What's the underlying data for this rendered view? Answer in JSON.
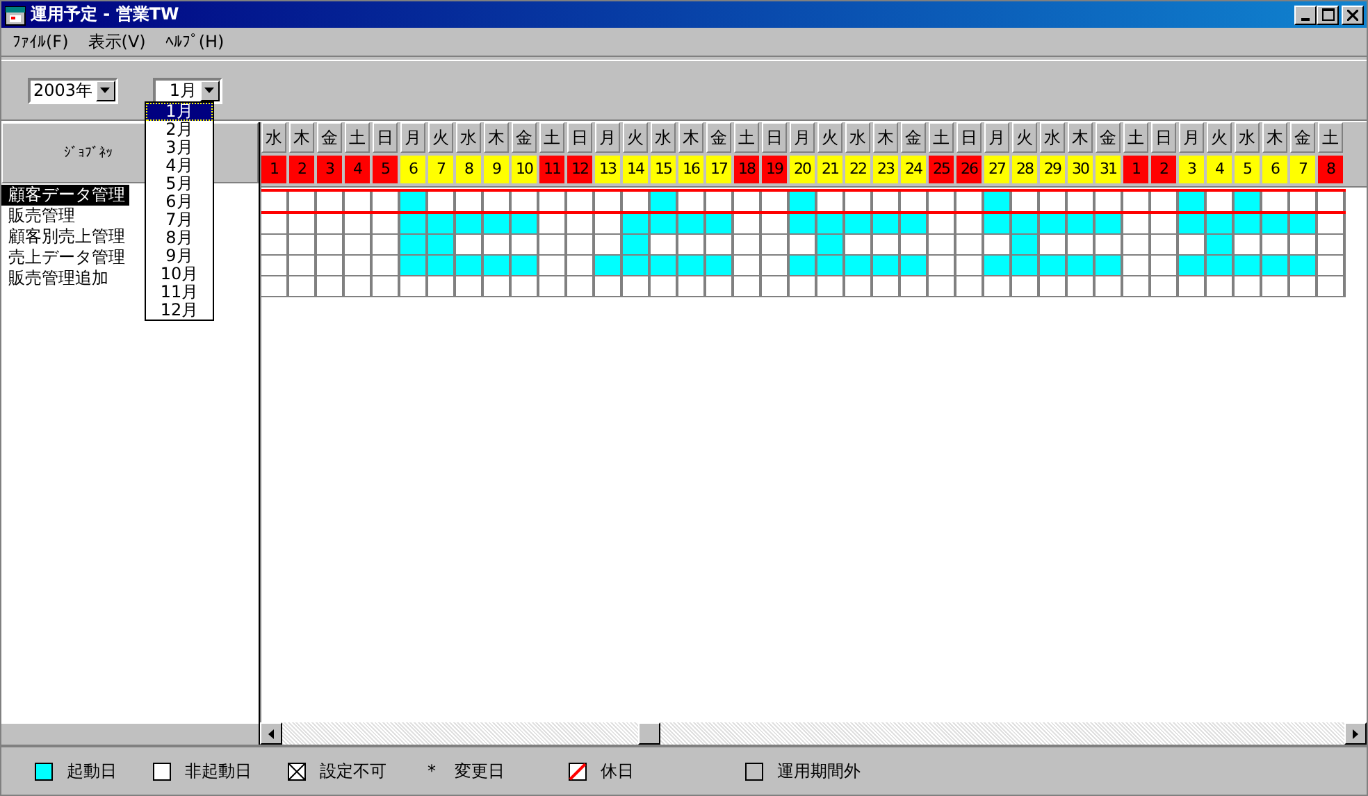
{
  "window": {
    "title": "運用予定 - 営業TW"
  },
  "menu": [
    "ﾌｧｲﾙ(F)",
    "表示(V)",
    "ﾍﾙﾌﾟ(H)"
  ],
  "year_select": {
    "value": "2003年"
  },
  "month_select": {
    "value": "1月",
    "expanded": true,
    "options": [
      {
        "label": "1月",
        "selected": true
      },
      {
        "label": "2月",
        "selected": false
      },
      {
        "label": "3月",
        "selected": false
      },
      {
        "label": "4月",
        "selected": false
      },
      {
        "label": "5月",
        "selected": false
      },
      {
        "label": "6月",
        "selected": false
      },
      {
        "label": "7月",
        "selected": false
      },
      {
        "label": "8月",
        "selected": false
      },
      {
        "label": "9月",
        "selected": false
      },
      {
        "label": "10月",
        "selected": false
      },
      {
        "label": "11月",
        "selected": false
      },
      {
        "label": "12月",
        "selected": false
      }
    ]
  },
  "job_header": "ｼﾞｮﾌﾞﾈｯ",
  "days": [
    {
      "weekday": "水",
      "date": "1",
      "holiday": true
    },
    {
      "weekday": "木",
      "date": "2",
      "holiday": true
    },
    {
      "weekday": "金",
      "date": "3",
      "holiday": true
    },
    {
      "weekday": "土",
      "date": "4",
      "holiday": true
    },
    {
      "weekday": "日",
      "date": "5",
      "holiday": true
    },
    {
      "weekday": "月",
      "date": "6",
      "holiday": false
    },
    {
      "weekday": "火",
      "date": "7",
      "holiday": false
    },
    {
      "weekday": "水",
      "date": "8",
      "holiday": false
    },
    {
      "weekday": "木",
      "date": "9",
      "holiday": false
    },
    {
      "weekday": "金",
      "date": "10",
      "holiday": false
    },
    {
      "weekday": "土",
      "date": "11",
      "holiday": true
    },
    {
      "weekday": "日",
      "date": "12",
      "holiday": true
    },
    {
      "weekday": "月",
      "date": "13",
      "holiday": false
    },
    {
      "weekday": "火",
      "date": "14",
      "holiday": false
    },
    {
      "weekday": "水",
      "date": "15",
      "holiday": false
    },
    {
      "weekday": "木",
      "date": "16",
      "holiday": false
    },
    {
      "weekday": "金",
      "date": "17",
      "holiday": false
    },
    {
      "weekday": "土",
      "date": "18",
      "holiday": true
    },
    {
      "weekday": "日",
      "date": "19",
      "holiday": true
    },
    {
      "weekday": "月",
      "date": "20",
      "holiday": false
    },
    {
      "weekday": "火",
      "date": "21",
      "holiday": false
    },
    {
      "weekday": "水",
      "date": "22",
      "holiday": false
    },
    {
      "weekday": "木",
      "date": "23",
      "holiday": false
    },
    {
      "weekday": "金",
      "date": "24",
      "holiday": false
    },
    {
      "weekday": "土",
      "date": "25",
      "holiday": true
    },
    {
      "weekday": "日",
      "date": "26",
      "holiday": true
    },
    {
      "weekday": "月",
      "date": "27",
      "holiday": false
    },
    {
      "weekday": "火",
      "date": "28",
      "holiday": false
    },
    {
      "weekday": "水",
      "date": "29",
      "holiday": false
    },
    {
      "weekday": "木",
      "date": "30",
      "holiday": false
    },
    {
      "weekday": "金",
      "date": "31",
      "holiday": false
    },
    {
      "weekday": "土",
      "date": "1",
      "holiday": true
    },
    {
      "weekday": "日",
      "date": "2",
      "holiday": true
    },
    {
      "weekday": "月",
      "date": "3",
      "holiday": false
    },
    {
      "weekday": "火",
      "date": "4",
      "holiday": false
    },
    {
      "weekday": "水",
      "date": "5",
      "holiday": false
    },
    {
      "weekday": "木",
      "date": "6",
      "holiday": false
    },
    {
      "weekday": "金",
      "date": "7",
      "holiday": false
    },
    {
      "weekday": "土",
      "date": "8",
      "holiday": true
    }
  ],
  "jobs": [
    {
      "name": "顧客データ管理",
      "selected": true,
      "schedule": [
        false,
        false,
        false,
        false,
        false,
        true,
        false,
        false,
        false,
        false,
        false,
        false,
        false,
        false,
        true,
        false,
        false,
        false,
        false,
        true,
        false,
        false,
        false,
        false,
        false,
        false,
        true,
        false,
        false,
        false,
        false,
        false,
        false,
        true,
        false,
        true,
        false,
        false,
        false
      ]
    },
    {
      "name": "販売管理",
      "selected": false,
      "schedule": [
        false,
        false,
        false,
        false,
        false,
        true,
        true,
        true,
        true,
        true,
        false,
        false,
        false,
        true,
        true,
        true,
        true,
        false,
        false,
        true,
        true,
        true,
        true,
        true,
        false,
        false,
        true,
        true,
        true,
        true,
        true,
        false,
        false,
        true,
        true,
        true,
        true,
        true,
        false
      ]
    },
    {
      "name": "顧客別売上管理",
      "selected": false,
      "schedule": [
        false,
        false,
        false,
        false,
        false,
        true,
        true,
        false,
        false,
        false,
        false,
        false,
        false,
        true,
        false,
        false,
        false,
        false,
        false,
        false,
        true,
        false,
        false,
        false,
        false,
        false,
        false,
        true,
        false,
        false,
        false,
        false,
        false,
        false,
        true,
        false,
        false,
        false,
        false
      ]
    },
    {
      "name": "売上データ管理",
      "selected": false,
      "schedule": [
        false,
        false,
        false,
        false,
        false,
        true,
        true,
        true,
        true,
        true,
        false,
        false,
        true,
        true,
        true,
        true,
        true,
        false,
        false,
        true,
        true,
        true,
        true,
        true,
        false,
        false,
        true,
        true,
        true,
        true,
        true,
        false,
        false,
        true,
        true,
        true,
        true,
        true,
        false
      ]
    },
    {
      "name": "販売管理追加",
      "selected": false,
      "schedule": [
        false,
        false,
        false,
        false,
        false,
        false,
        false,
        false,
        false,
        false,
        false,
        false,
        false,
        false,
        false,
        false,
        false,
        false,
        false,
        false,
        false,
        false,
        false,
        false,
        false,
        false,
        false,
        false,
        false,
        false,
        false,
        false,
        false,
        false,
        false,
        false,
        false,
        false,
        false
      ]
    }
  ],
  "legend": [
    {
      "kind": "start",
      "label": "起動日"
    },
    {
      "kind": "nostart",
      "label": "非起動日"
    },
    {
      "kind": "disabled",
      "label": "設定不可"
    },
    {
      "kind": "changed",
      "symbol": "*",
      "label": "変更日"
    },
    {
      "kind": "holiday",
      "label": "休日"
    },
    {
      "kind": "outside",
      "label": "運用期間外"
    }
  ]
}
